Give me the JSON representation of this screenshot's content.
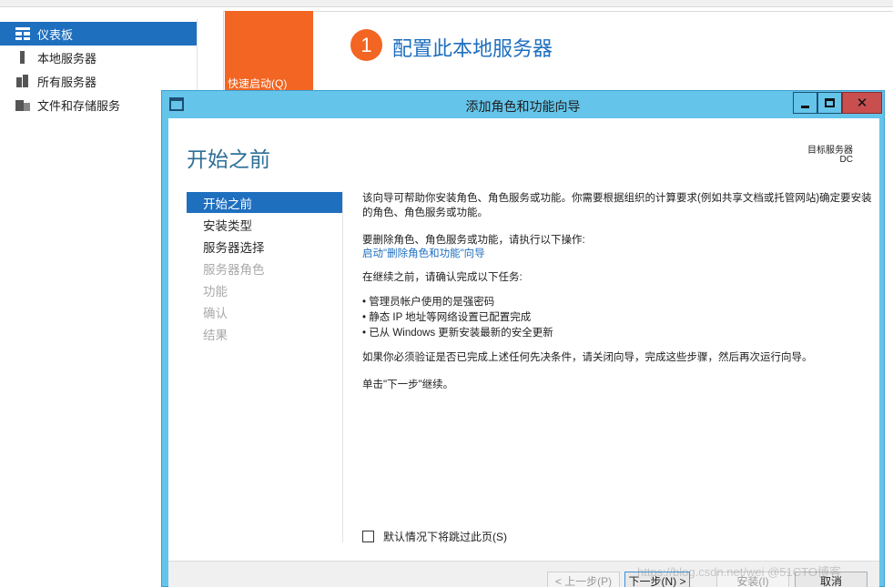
{
  "sidebar": {
    "items": [
      {
        "label": "仪表板",
        "icon": "dashboard-icon",
        "active": true
      },
      {
        "label": "本地服务器",
        "icon": "server-icon",
        "active": false
      },
      {
        "label": "所有服务器",
        "icon": "servers-icon",
        "active": false
      },
      {
        "label": "文件和存储服务",
        "icon": "files-storage-icon",
        "active": false
      }
    ]
  },
  "dashboard": {
    "quick_start_label": "快速启动(Q)",
    "step_number": "1",
    "step_title": "配置此本地服务器"
  },
  "dialog": {
    "title": "添加角色和功能向导",
    "header_title": "开始之前",
    "target_server_label": "目标服务器",
    "target_server_value": "DC",
    "nav": [
      {
        "label": "开始之前",
        "state": "current"
      },
      {
        "label": "安装类型",
        "state": "enabled"
      },
      {
        "label": "服务器选择",
        "state": "enabled"
      },
      {
        "label": "服务器角色",
        "state": "disabled"
      },
      {
        "label": "功能",
        "state": "disabled"
      },
      {
        "label": "确认",
        "state": "disabled"
      },
      {
        "label": "结果",
        "state": "disabled"
      }
    ],
    "content": {
      "intro": "该向导可帮助你安装角色、角色服务或功能。你需要根据组织的计算要求(例如共享文档或托管网站)确定要安装的角色、角色服务或功能。",
      "remove_text": "要删除角色、角色服务或功能，请执行以下操作:",
      "remove_link": "启动\"删除角色和功能\"向导",
      "before_continue": "在继续之前，请确认完成以下任务:",
      "tasks": [
        "管理员帐户使用的是强密码",
        "静态 IP 地址等网络设置已配置完成",
        "已从 Windows 更新安装最新的安全更新"
      ],
      "prereq_note": "如果你必须验证是否已完成上述任何先决条件，请关闭向导，完成这些步骤，然后再次运行向导。",
      "next_hint": "单击\"下一步\"继续。"
    },
    "skip_checkbox_label": "默认情况下将跳过此页(S)",
    "buttons": {
      "prev": "< 上一步(P)",
      "next": "下一步(N) >",
      "install": "安装(I)",
      "cancel": "取消"
    }
  },
  "watermark": "https://blog.csdn.net/wei @51CTO博客",
  "colors": {
    "accent_blue": "#1f6fbf",
    "tile_orange": "#f26522",
    "dialog_frame": "#65c4ea",
    "close_red": "#c94f4f"
  }
}
